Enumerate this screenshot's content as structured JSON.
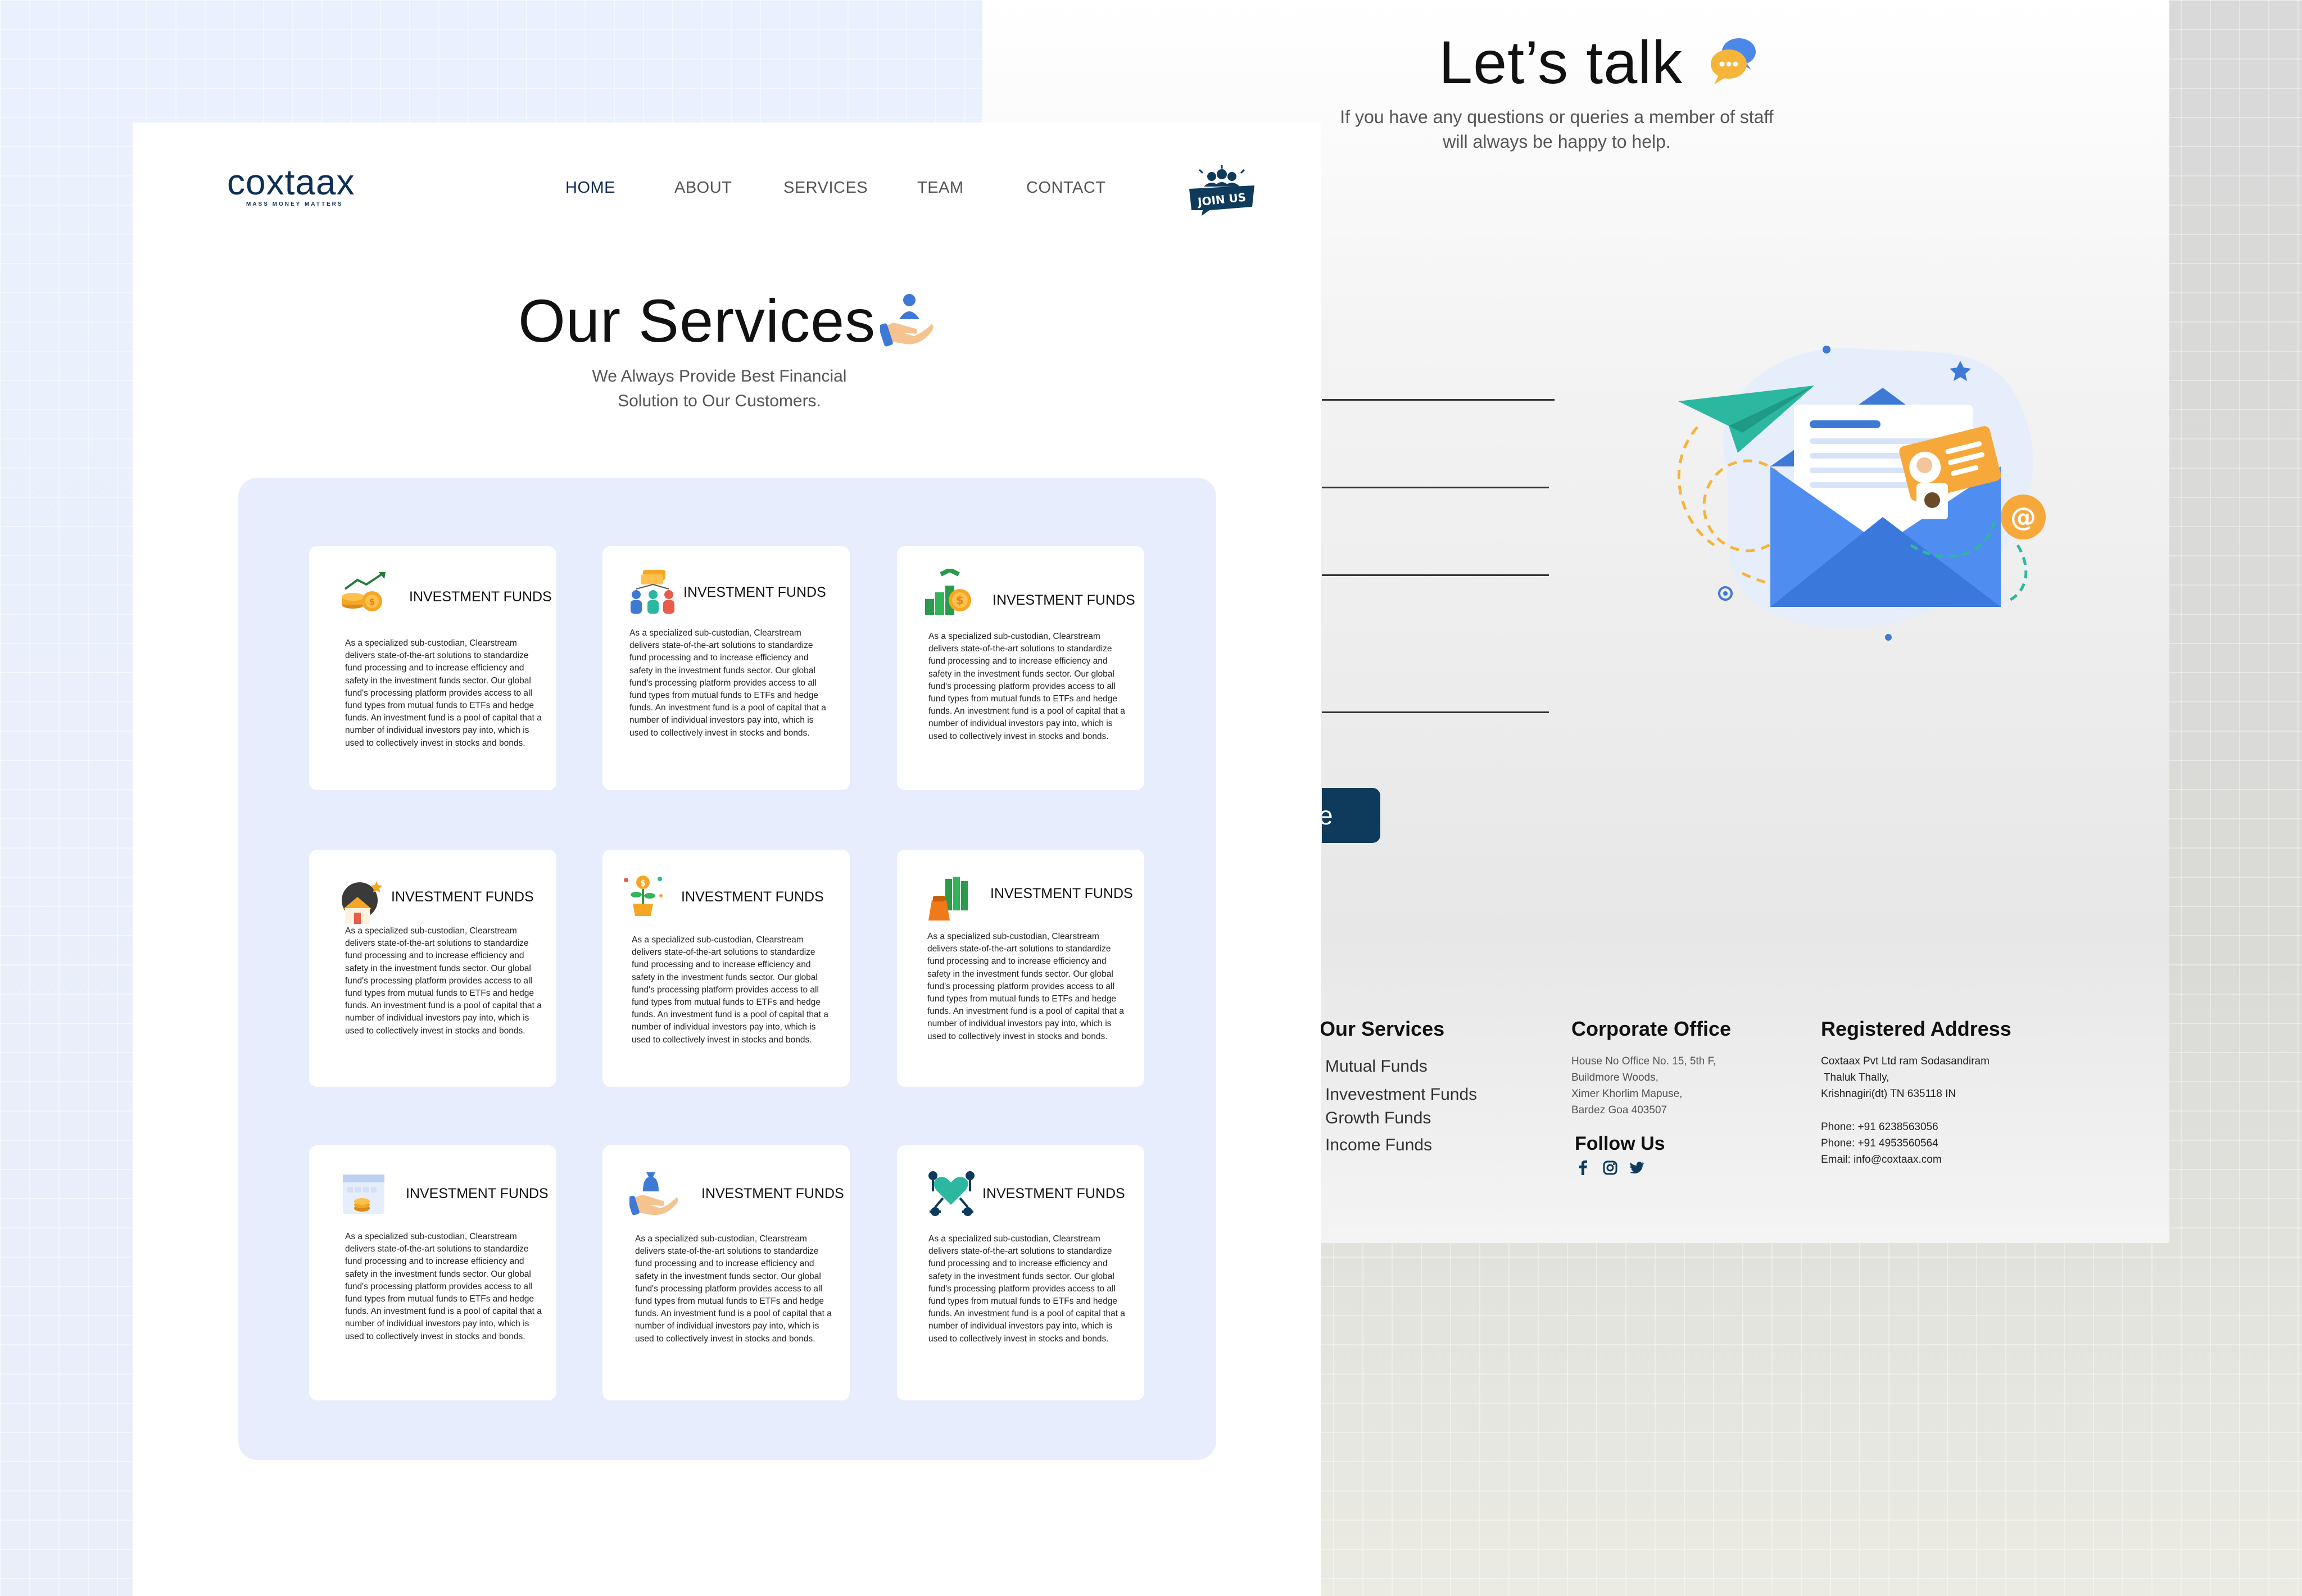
{
  "contact": {
    "title": "Let’s talk",
    "subtitle": "If you have any questions or queries a member of staff will always be happy to help.",
    "submit_label": "e",
    "chat_icon": "chat-bubbles-icon",
    "illustration": "email-envelope-illustration"
  },
  "footer": {
    "services": {
      "heading": "Our Services",
      "items": [
        "Mutual Funds",
        "Invevestment Funds",
        "Growth Funds",
        "Income Funds"
      ]
    },
    "office": {
      "heading": "Corporate Office",
      "lines": [
        "House No Office No. 15, 5th F,",
        "Buildmore Woods,",
        "Ximer Khorlim Mapuse,",
        "Bardez Goa 403507"
      ],
      "follow_heading": "Follow Us",
      "social": [
        "facebook-icon",
        "instagram-icon",
        "twitter-icon"
      ]
    },
    "registered": {
      "heading": "Registered Address",
      "lines": [
        "Coxtaax Pvt Ltd ram Sodasandiram",
        " Thaluk Thally,",
        "Krishnagiri(dt) TN 635118 IN"
      ],
      "phone1": "Phone: +91 6238563056",
      "phone2": "Phone: +91 4953560564",
      "email": "Email: info@coxtaax.com"
    }
  },
  "header": {
    "logo_text": "coxtaax",
    "logo_tagline": "MASS MONEY MATTERS",
    "nav": [
      "HOME",
      "ABOUT",
      "SERVICES",
      "TEAM",
      "CONTACT"
    ],
    "active_nav": "HOME",
    "join_label": "JOIN US"
  },
  "services": {
    "title": "Our Services",
    "subtitle": "We Always Provide Best Financial Solution to Our Customers.",
    "title_icon": "hand-person-icon",
    "cards": [
      {
        "title": "INVESTMENT FUNDS",
        "icon": "coin-growth-icon"
      },
      {
        "title": "INVESTMENT FUNDS",
        "icon": "team-money-icon"
      },
      {
        "title": "INVESTMENT FUNDS",
        "icon": "growth-dollar-icon"
      },
      {
        "title": "INVESTMENT FUNDS",
        "icon": "house-bag-icon"
      },
      {
        "title": "INVESTMENT FUNDS",
        "icon": "money-plant-icon"
      },
      {
        "title": "INVESTMENT FUNDS",
        "icon": "money-stack-icon"
      },
      {
        "title": "INVESTMENT FUNDS",
        "icon": "calendar-coin-icon"
      },
      {
        "title": "INVESTMENT FUNDS",
        "icon": "hand-bag-icon"
      },
      {
        "title": "INVESTMENT FUNDS",
        "icon": "heart-network-icon"
      }
    ],
    "card_body": "As a specialized sub-custodian, Clearstream delivers state-of-the-art solutions to standardize fund processing and to increase efficiency and safety in the investment funds sector. Our global fund's processing platform provides access to all fund types from mutual funds to ETFs and hedge funds. An investment fund is a pool of capital that a number of individual investors pay into, which is used to collectively invest in stocks and bonds."
  }
}
